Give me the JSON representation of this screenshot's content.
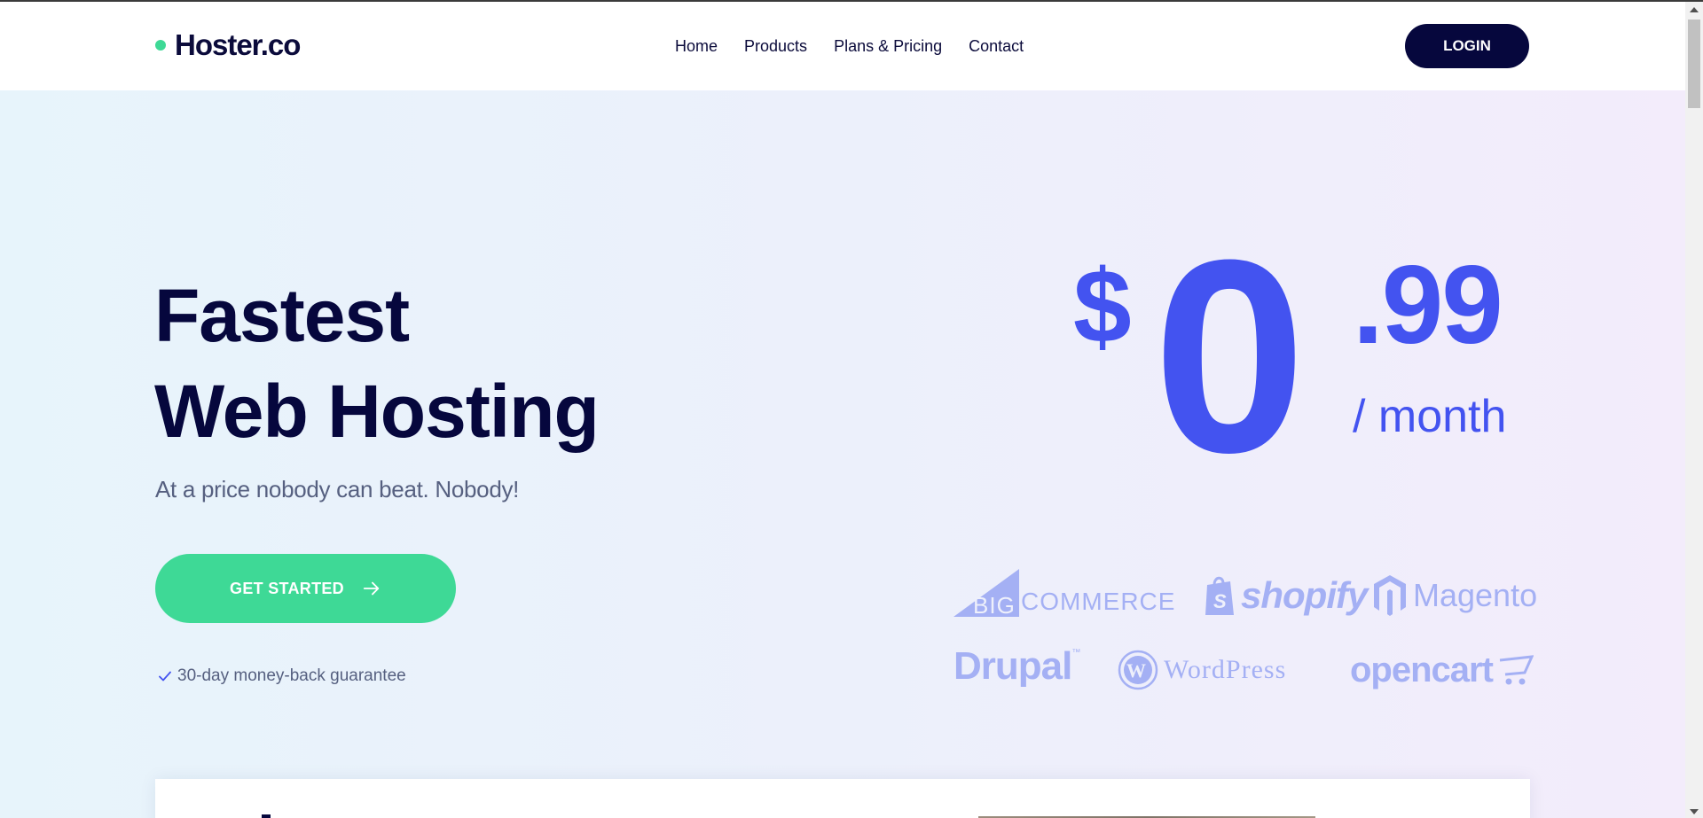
{
  "header": {
    "logo_text": "Hoster.co",
    "nav": [
      {
        "label": "Home"
      },
      {
        "label": "Products"
      },
      {
        "label": "Plans & Pricing"
      },
      {
        "label": "Contact"
      }
    ],
    "login_label": "LOGIN"
  },
  "hero": {
    "headline_line1": "Fastest",
    "headline_line2": "Web Hosting",
    "subhead": "At a price nobody can beat. Nobody!",
    "cta_label": "GET STARTED",
    "cta_icon": "arrow-right-icon",
    "guarantee_icon": "check-icon",
    "guarantee_text": "30-day money-back guarantee"
  },
  "price": {
    "currency": "$",
    "whole": "0",
    "cents": ".99",
    "period": "/ month"
  },
  "logos": {
    "bigcommerce_big": "BIG",
    "bigcommerce_rest": "COMMERCE",
    "shopify": "shopify",
    "magento": "Magento",
    "drupal": "Drupal",
    "drupal_tm": "™",
    "wordpress": "WordPress",
    "opencart": "opencart"
  },
  "colors": {
    "brand_dark": "#06073d",
    "accent_green": "#3ed996",
    "price_blue": "#4353f0",
    "logo_tint": "#a4b0f4"
  }
}
